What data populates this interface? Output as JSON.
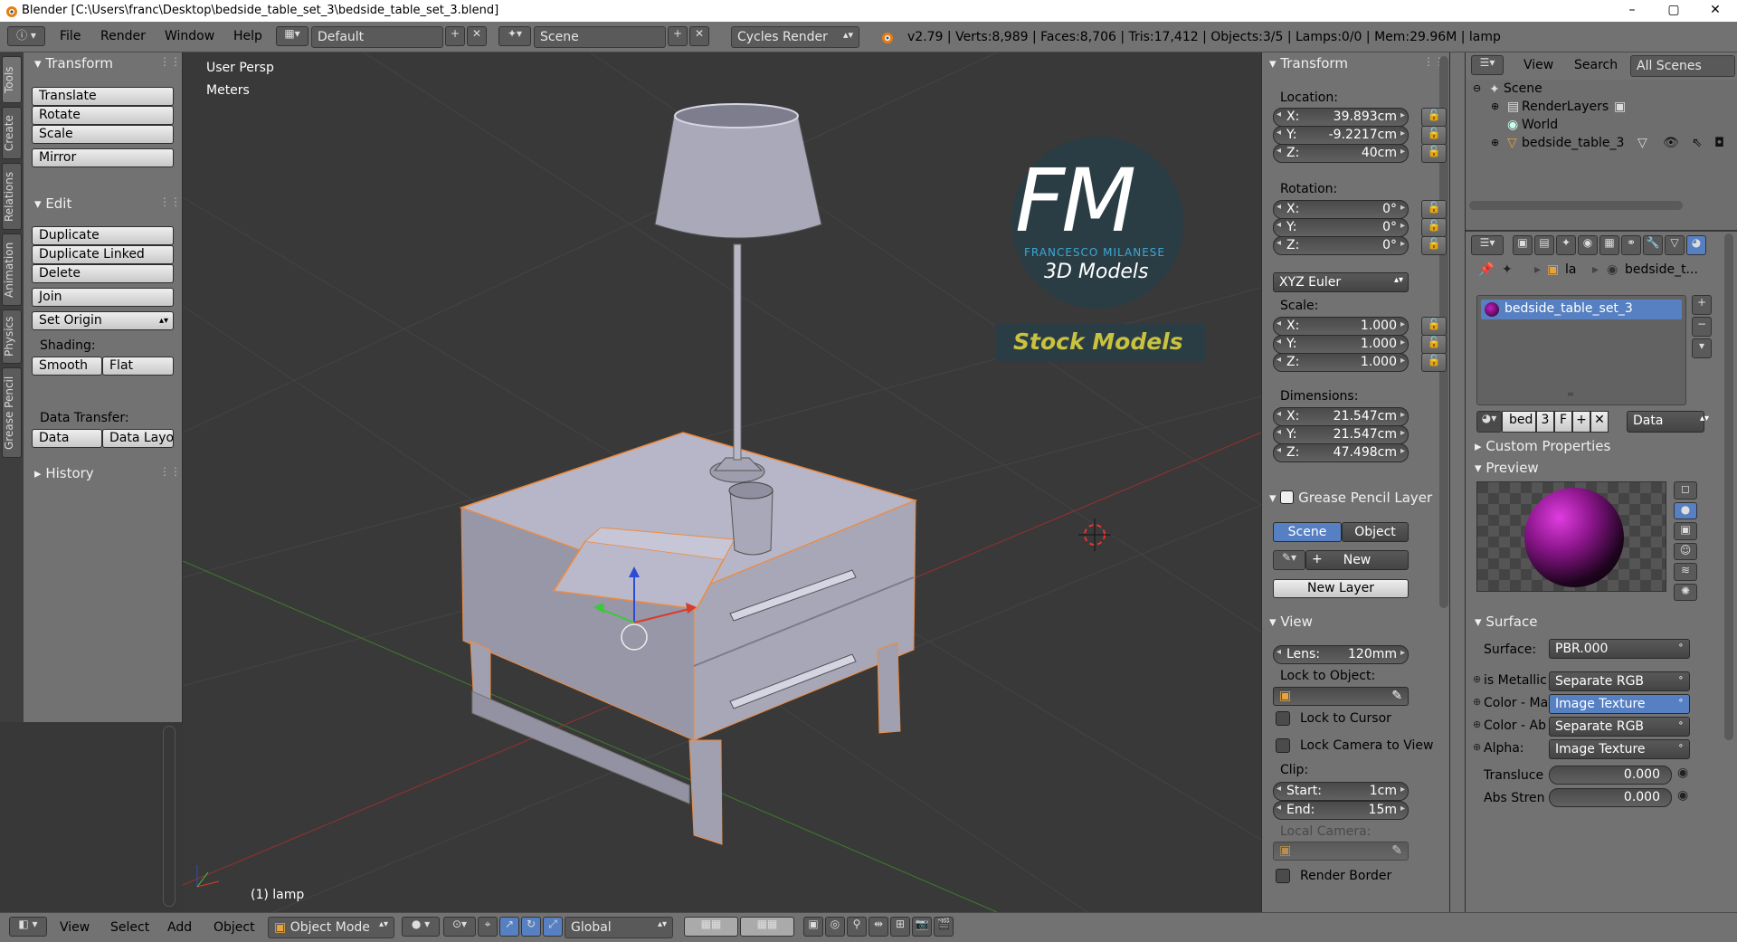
{
  "window": {
    "title": "Blender [C:\\Users\\franc\\Desktop\\bedside_table_set_3\\bedside_table_set_3.blend]",
    "controls": [
      "–",
      "▢",
      "✕"
    ]
  },
  "info_header": {
    "menus": [
      "File",
      "Render",
      "Window",
      "Help"
    ],
    "screen_layout": "Default",
    "scene": "Scene",
    "render_engine": "Cycles Render",
    "stats": "v2.79 | Verts:8,989 | Faces:8,706 | Tris:17,412 | Objects:3/5 | Lamps:0/0 | Mem:29.96M | lamp"
  },
  "tabs": [
    "Tools",
    "Create",
    "Relations",
    "Animation",
    "Physics",
    "Grease Pencil"
  ],
  "toolshelf": {
    "transform_title": "Transform",
    "translate": "Translate",
    "rotate": "Rotate",
    "scale": "Scale",
    "mirror": "Mirror",
    "edit_title": "Edit",
    "duplicate": "Duplicate",
    "duplicate_linked": "Duplicate Linked",
    "delete": "Delete",
    "join": "Join",
    "set_origin": "Set Origin",
    "shading_label": "Shading:",
    "smooth": "Smooth",
    "flat": "Flat",
    "data_transfer_label": "Data Transfer:",
    "data": "Data",
    "data_layout": "Data Layo",
    "history_title": "History"
  },
  "viewport": {
    "view_name": "User Persp",
    "units": "Meters",
    "active_object": "(1) lamp",
    "watermark": {
      "logo": "FM",
      "brand": "FRANCESCO MILANESE",
      "subtitle": "3D Models",
      "banner": "Stock Models"
    }
  },
  "npanel": {
    "transform_title": "Transform",
    "location_label": "Location:",
    "location": [
      {
        "axis": "X:",
        "value": "39.893cm"
      },
      {
        "axis": "Y:",
        "value": "-9.2217cm"
      },
      {
        "axis": "Z:",
        "value": "40cm"
      }
    ],
    "rotation_label": "Rotation:",
    "rotation": [
      {
        "axis": "X:",
        "value": "0°"
      },
      {
        "axis": "Y:",
        "value": "0°"
      },
      {
        "axis": "Z:",
        "value": "0°"
      }
    ],
    "rotation_mode": "XYZ Euler",
    "scale_label": "Scale:",
    "scale": [
      {
        "axis": "X:",
        "value": "1.000"
      },
      {
        "axis": "Y:",
        "value": "1.000"
      },
      {
        "axis": "Z:",
        "value": "1.000"
      }
    ],
    "dimensions_label": "Dimensions:",
    "dimensions": [
      {
        "axis": "X:",
        "value": "21.547cm"
      },
      {
        "axis": "Y:",
        "value": "21.547cm"
      },
      {
        "axis": "Z:",
        "value": "47.498cm"
      }
    ],
    "grease_pencil_title": "Grease Pencil Layer",
    "gp_scene": "Scene",
    "gp_object": "Object",
    "gp_new": "New",
    "gp_new_layer": "New Layer",
    "view_title": "View",
    "lens_label": "Lens:",
    "lens_value": "120mm",
    "lock_to_object": "Lock to Object:",
    "lock_to_cursor": "Lock to Cursor",
    "lock_camera": "Lock Camera to View",
    "clip_label": "Clip:",
    "clip_start_label": "Start:",
    "clip_start": "1cm",
    "clip_end_label": "End:",
    "clip_end": "15m",
    "local_camera": "Local Camera:",
    "render_border": "Render Border"
  },
  "outliner": {
    "view": "View",
    "search": "Search",
    "filter": "All Scenes",
    "items": [
      "Scene",
      "RenderLayers",
      "World",
      "bedside_table_3"
    ]
  },
  "properties": {
    "breadcrumb_object": "la",
    "breadcrumb_material": "bedside_t...",
    "material_slot": "bedside_table_set_3",
    "material_name": "bed",
    "users": "3",
    "fake": "F",
    "link": "Data",
    "custom_properties": "Custom Properties",
    "preview_title": "Preview",
    "surface_title": "Surface",
    "surface_label": "Surface:",
    "surface_value": "PBR.000",
    "inputs": [
      {
        "label": "is Metallic",
        "value": "Separate RGB"
      },
      {
        "label": "Color - Ma",
        "value": "Image Texture"
      },
      {
        "label": "Color - Ab",
        "value": "Separate RGB"
      },
      {
        "label": "Alpha:",
        "value": "Image Texture"
      }
    ],
    "translucence_label": "Transluce",
    "translucence_value": "0.000",
    "abs_strength_label": "Abs Stren",
    "abs_strength_value": "0.000"
  },
  "bottom_header": {
    "menus": [
      "View",
      "Select",
      "Add",
      "Object"
    ],
    "mode": "Object Mode",
    "orientation": "Global"
  },
  "colors": {
    "panel_bg": "#727272",
    "viewport_bg": "#393939",
    "selection_orange": "#f08a3c",
    "selected_slot": "#5680c2",
    "active_toggle": "#5680c2"
  }
}
